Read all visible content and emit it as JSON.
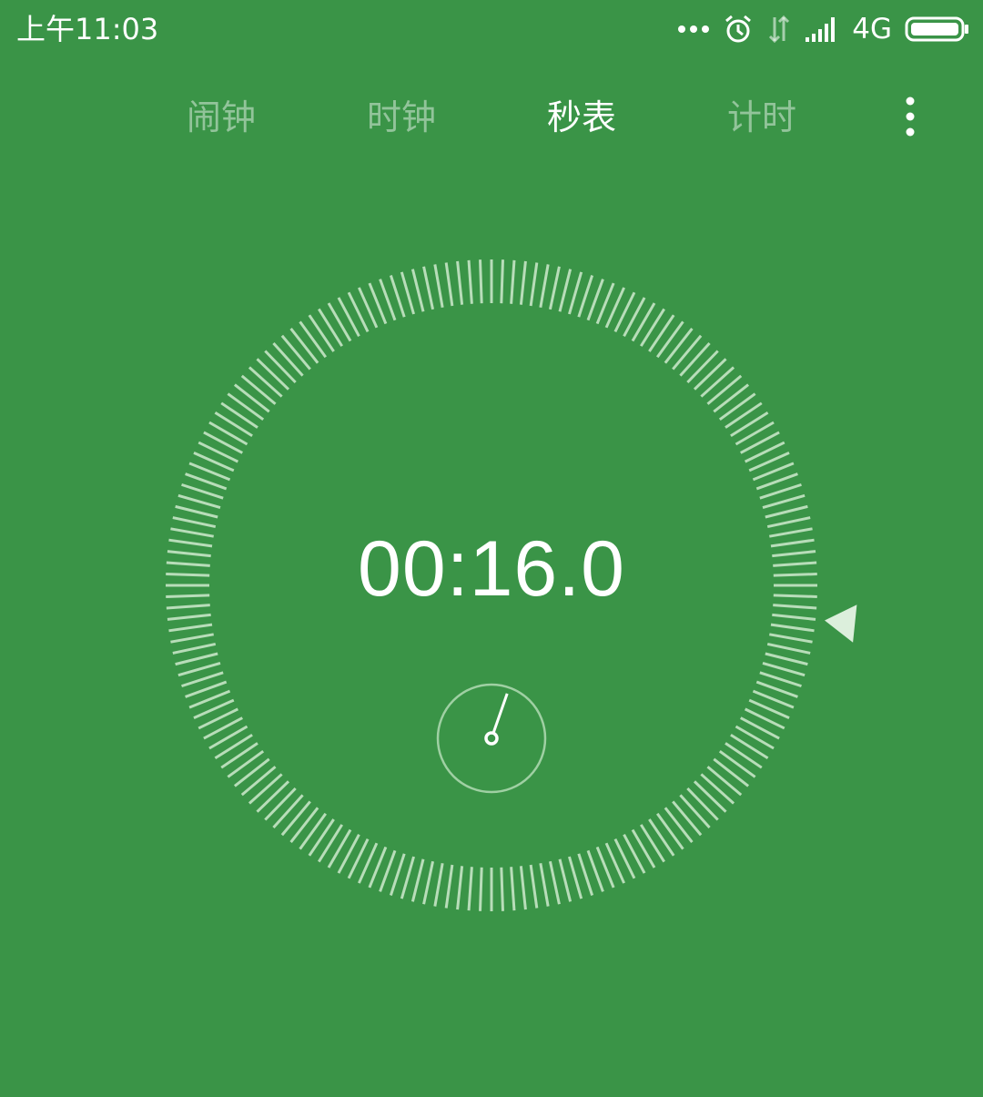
{
  "status_bar": {
    "time": "上午11:03",
    "network": "4G",
    "icons": [
      "more-dots-icon",
      "alarm-clock-icon",
      "data-transfer-icon",
      "signal-strength-icon",
      "battery-icon"
    ]
  },
  "tabs": [
    {
      "label": "闹钟",
      "active": false
    },
    {
      "label": "时钟",
      "active": false
    },
    {
      "label": "秒表",
      "active": true
    },
    {
      "label": "计时",
      "active": false
    }
  ],
  "stopwatch": {
    "elapsed": "00:16.0",
    "seconds_fraction": 0.2667,
    "sub_dial_icon": "minute-sub-dial-icon",
    "marker_icon": "seconds-pointer-triangle-icon"
  },
  "colors": {
    "background": "#3a9447",
    "tick": "#b8ddb9",
    "text": "#ffffff",
    "inactive_tab": "rgba(255,255,255,0.45)"
  }
}
